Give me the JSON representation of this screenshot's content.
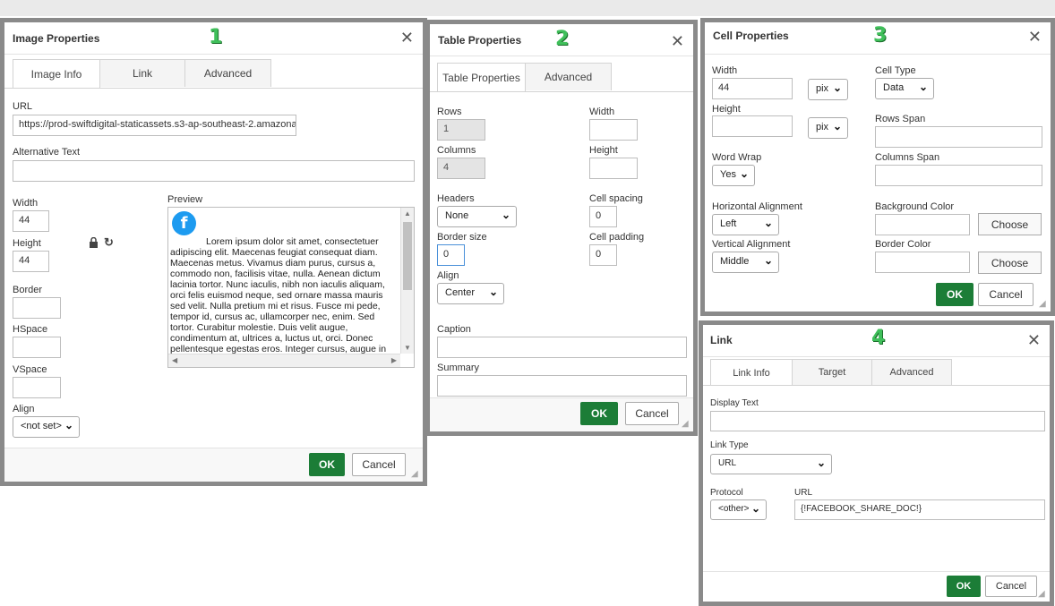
{
  "image_dialog": {
    "title": "Image Properties",
    "badge": "1",
    "tabs": [
      "Image Info",
      "Link",
      "Advanced"
    ],
    "url_label": "URL",
    "url_value": "https://prod-swiftdigital-staticassets.s3-ap-southeast-2.amazona",
    "alt_label": "Alternative Text",
    "alt_value": "",
    "width_label": "Width",
    "width_value": "44",
    "height_label": "Height",
    "height_value": "44",
    "border_label": "Border",
    "hspace_label": "HSpace",
    "vspace_label": "VSpace",
    "align_label": "Align",
    "align_value": "<not set>",
    "preview_label": "Preview",
    "preview_text": "Lorem ipsum dolor sit amet, consectetuer adipiscing elit. Maecenas feugiat consequat diam. Maecenas metus. Vivamus diam purus, cursus a, commodo non, facilisis vitae, nulla. Aenean dictum lacinia tortor. Nunc iaculis, nibh non iaculis aliquam, orci felis euismod neque, sed ornare massa mauris sed velit. Nulla pretium mi et risus. Fusce mi pede, tempor id, cursus ac, ullamcorper nec, enim. Sed tortor. Curabitur molestie. Duis velit augue, condimentum at, ultrices a, luctus ut, orci. Donec pellentesque egestas eros. Integer cursus, augue in",
    "ok": "OK",
    "cancel": "Cancel"
  },
  "table_dialog": {
    "title": "Table Properties",
    "badge": "2",
    "tabs": [
      "Table Properties",
      "Advanced"
    ],
    "rows_label": "Rows",
    "rows_value": "1",
    "columns_label": "Columns",
    "columns_value": "4",
    "width_label": "Width",
    "height_label": "Height",
    "headers_label": "Headers",
    "headers_value": "None",
    "cell_spacing_label": "Cell spacing",
    "cell_spacing_value": "0",
    "border_size_label": "Border size",
    "border_size_value": "0",
    "cell_padding_label": "Cell padding",
    "cell_padding_value": "0",
    "align_label": "Align",
    "align_value": "Center",
    "caption_label": "Caption",
    "summary_label": "Summary",
    "ok": "OK",
    "cancel": "Cancel"
  },
  "cell_dialog": {
    "title": "Cell Properties",
    "badge": "3",
    "width_label": "Width",
    "width_value": "44",
    "width_unit": "pix",
    "height_label": "Height",
    "height_unit": "pix",
    "cell_type_label": "Cell Type",
    "cell_type_value": "Data",
    "rows_span_label": "Rows Span",
    "word_wrap_label": "Word Wrap",
    "word_wrap_value": "Yes",
    "columns_span_label": "Columns Span",
    "h_align_label": "Horizontal Alignment",
    "h_align_value": "Left",
    "bg_color_label": "Background Color",
    "v_align_label": "Vertical Alignment",
    "v_align_value": "Middle",
    "border_color_label": "Border Color",
    "choose": "Choose",
    "ok": "OK",
    "cancel": "Cancel"
  },
  "link_dialog": {
    "title": "Link",
    "badge": "4",
    "tabs": [
      "Link Info",
      "Target",
      "Advanced"
    ],
    "display_text_label": "Display Text",
    "link_type_label": "Link Type",
    "link_type_value": "URL",
    "protocol_label": "Protocol",
    "protocol_value": "<other>",
    "url_label": "URL",
    "url_value": "{!FACEBOOK_SHARE_DOC!}",
    "ok": "OK",
    "cancel": "Cancel"
  },
  "colors": {
    "ok_button": "#1c7d37",
    "badge": "#3fbf5a",
    "dialog_border": "#8a8a8a",
    "facebook": "#1d9bf0"
  },
  "icons": [
    "close-icon",
    "lock-icon",
    "reset-icon",
    "chevron-down-icon",
    "facebook-icon",
    "resize-grip-icon"
  ]
}
